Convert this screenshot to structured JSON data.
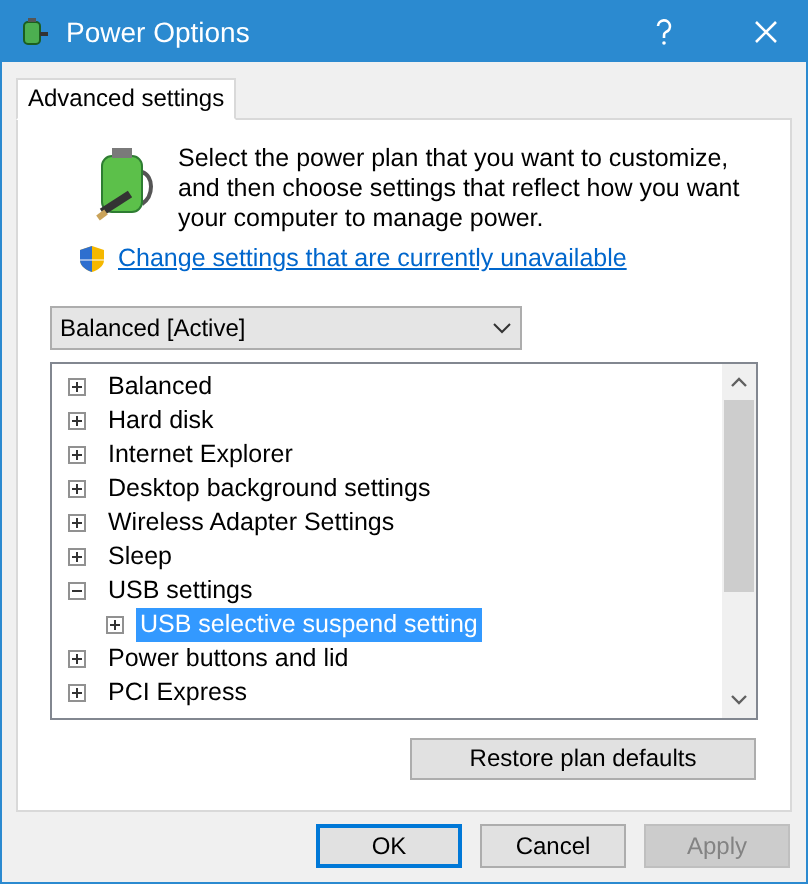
{
  "window": {
    "title": "Power Options"
  },
  "tabs": [
    {
      "label": "Advanced settings",
      "selected": true
    }
  ],
  "description": "Select the power plan that you want to customize, and then choose settings that reflect how you want your computer to manage power.",
  "link": "Change settings that are currently unavailable",
  "plan_dropdown": {
    "value": "Balanced [Active]"
  },
  "tree": [
    {
      "label": "Balanced",
      "expanded": false,
      "selected": false
    },
    {
      "label": "Hard disk",
      "expanded": false,
      "selected": false
    },
    {
      "label": "Internet Explorer",
      "expanded": false,
      "selected": false
    },
    {
      "label": "Desktop background settings",
      "expanded": false,
      "selected": false
    },
    {
      "label": "Wireless Adapter Settings",
      "expanded": false,
      "selected": false
    },
    {
      "label": "Sleep",
      "expanded": false,
      "selected": false
    },
    {
      "label": "USB settings",
      "expanded": true,
      "selected": false,
      "children": [
        {
          "label": "USB selective suspend setting",
          "expanded": false,
          "selected": true
        }
      ]
    },
    {
      "label": "Power buttons and lid",
      "expanded": false,
      "selected": false
    },
    {
      "label": "PCI Express",
      "expanded": false,
      "selected": false
    }
  ],
  "restore_button": "Restore plan defaults",
  "buttons": [
    {
      "label": "OK",
      "disabled": false,
      "default": true
    },
    {
      "label": "Cancel",
      "disabled": false,
      "default": false
    },
    {
      "label": "Apply",
      "disabled": true,
      "default": false
    }
  ]
}
